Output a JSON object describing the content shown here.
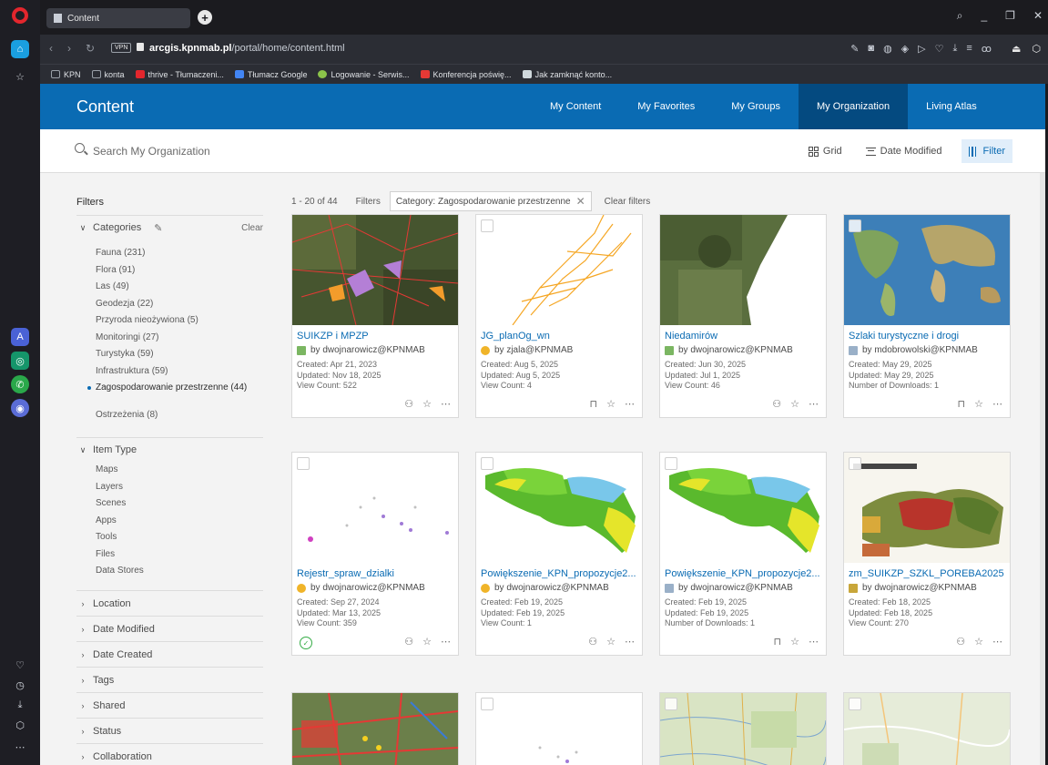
{
  "browser": {
    "tab_title": "Content",
    "url_host": "arcgis.kpnmab.pl",
    "url_path": "/portal/home/content.html",
    "vpn_label": "VPN",
    "bookmarks": [
      {
        "label": "KPN",
        "color": "#9aa0a8"
      },
      {
        "label": "konta",
        "color": "#9aa0a8"
      },
      {
        "label": "thrive - Tłumaczeni...",
        "color": "#e3262d"
      },
      {
        "label": "Tłumacz Google",
        "color": "#4285f4"
      },
      {
        "label": "Logowanie - Serwis...",
        "color": "#8bc34a"
      },
      {
        "label": "Konferencja poświę...",
        "color": "#e53935"
      },
      {
        "label": "Jak zamknąć konto...",
        "color": "#cfd8dc"
      }
    ]
  },
  "header": {
    "title": "Content",
    "nav": [
      "My Content",
      "My Favorites",
      "My Groups",
      "My Organization",
      "Living Atlas"
    ]
  },
  "search": {
    "placeholder": "Search My Organization"
  },
  "view": {
    "grid": "Grid",
    "sort": "Date Modified",
    "filter": "Filter"
  },
  "filters": {
    "title": "Filters",
    "categories_label": "Categories",
    "clear_label": "Clear",
    "categories": [
      "Fauna (231)",
      "Flora (91)",
      "Las (49)",
      "Geodezja (22)",
      "Przyroda nieożywiona (5)",
      "Monitoringi (27)",
      "Turystyka (59)",
      "Infrastruktura (59)"
    ],
    "selected_category": "Zagospodarowanie przestrzenne (44)",
    "categories_after": [
      "Ostrzeżenia (8)"
    ],
    "item_type_label": "Item Type",
    "item_types": [
      "Maps",
      "Layers",
      "Scenes",
      "Apps",
      "Tools",
      "Files",
      "Data Stores"
    ],
    "collapsed": [
      "Location",
      "Date Modified",
      "Date Created",
      "Tags",
      "Shared",
      "Status",
      "Collaboration"
    ]
  },
  "results": {
    "count": "1 - 20 of 44",
    "filters_label": "Filters",
    "chip": "Category: Zagospodarowanie przestrzenne",
    "clear_filters": "Clear filters"
  },
  "cards": [
    {
      "title": "SUIKZP i MPZP",
      "owner": "by dwojnarowicz@KPNMAB",
      "l1": "Created: Apr 21, 2023",
      "l2": "Updated: Nov 18, 2025",
      "l3": "View Count: 522",
      "type_color": "#7bb662"
    },
    {
      "title": "JG_planOg_wn",
      "owner": "by zjala@KPNMAB",
      "l1": "Created: Aug 5, 2025",
      "l2": "Updated: Aug 5, 2025",
      "l3": "View Count: 4",
      "type_color": "#f0b429"
    },
    {
      "title": "Niedamirów",
      "owner": "by dwojnarowicz@KPNMAB",
      "l1": "Created: Jun 30, 2025",
      "l2": "Updated: Jul 1, 2025",
      "l3": "View Count: 46",
      "type_color": "#7bb662"
    },
    {
      "title": "Szlaki turystyczne i drogi",
      "owner": "by mdobrowolski@KPNMAB",
      "l1": "Created: May 29, 2025",
      "l2": "Updated: May 29, 2025",
      "l3": "Number of Downloads: 1",
      "type_color": "#9ab0c8"
    },
    {
      "title": "Rejestr_spraw_dzialki",
      "owner": "by dwojnarowicz@KPNMAB",
      "l1": "Created: Sep 27, 2024",
      "l2": "Updated: Mar 13, 2025",
      "l3": "View Count: 359",
      "type_color": "#f0b429"
    },
    {
      "title": "Powiększenie_KPN_propozycje2...",
      "owner": "by dwojnarowicz@KPNMAB",
      "l1": "Created: Feb 19, 2025",
      "l2": "Updated: Feb 19, 2025",
      "l3": "View Count: 1",
      "type_color": "#f0b429"
    },
    {
      "title": "Powiększenie_KPN_propozycje2...",
      "owner": "by dwojnarowicz@KPNMAB",
      "l1": "Created: Feb 19, 2025",
      "l2": "Updated: Feb 19, 2025",
      "l3": "Number of Downloads: 1",
      "type_color": "#9ab0c8"
    },
    {
      "title": "zm_SUIKZP_SZKL_POREBA2025",
      "owner": "by dwojnarowicz@KPNMAB",
      "l1": "Created: Feb 18, 2025",
      "l2": "Updated: Feb 18, 2025",
      "l3": "View Count: 270",
      "type_color": "#c8a63a"
    }
  ]
}
